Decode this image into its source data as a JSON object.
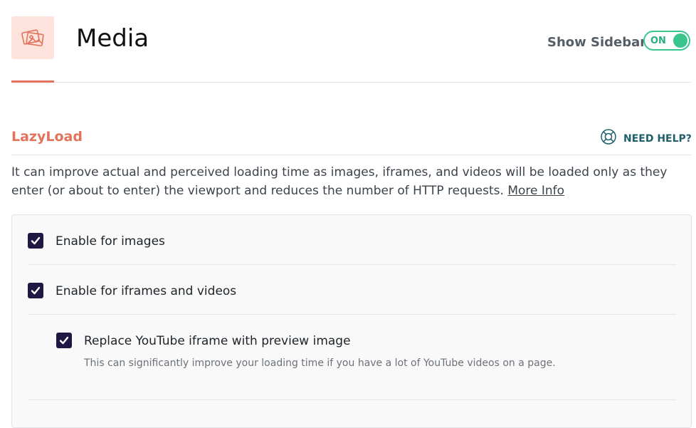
{
  "header": {
    "title": "Media",
    "icon": "media-images-icon",
    "sidebar_toggle": {
      "label": "Show Sidebar",
      "state": "ON",
      "on": true,
      "color": "#3bc58e"
    }
  },
  "section": {
    "title": "LazyLoad",
    "help_label": "NEED HELP?",
    "help_icon": "lifebuoy-icon",
    "description": "It can improve actual and perceived loading time as images, iframes, and videos will be loaded only as they enter (or about to enter) the viewport and reduces the number of HTTP requests.",
    "more_link": "More Info"
  },
  "options": [
    {
      "label": "Enable for images",
      "checked": true
    },
    {
      "label": "Enable for iframes and videos",
      "checked": true
    },
    {
      "label": "Replace YouTube iframe with preview image",
      "checked": true,
      "description": "This can significantly improve your loading time if you have a lot of YouTube videos on a page."
    }
  ],
  "colors": {
    "accent": "#e2735a",
    "checkbox": "#1e1842",
    "toggle": "#3bc58e"
  }
}
